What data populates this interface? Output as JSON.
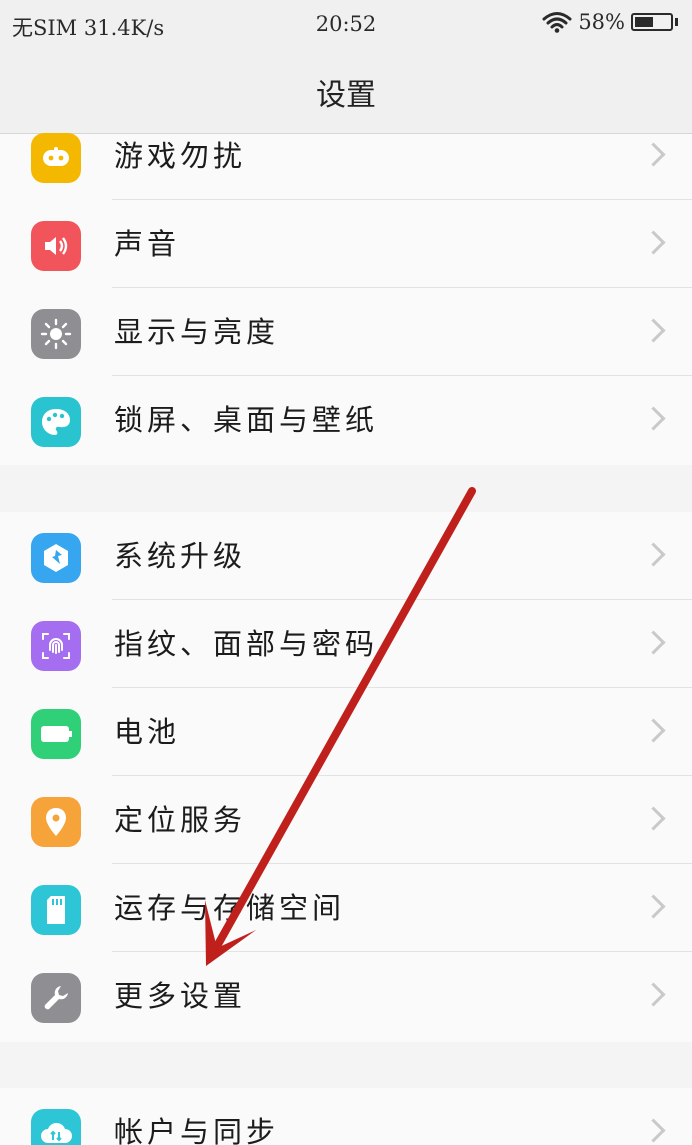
{
  "status": {
    "carrier": "无SIM 31.4K/s",
    "time": "20:52",
    "battery_percent": "58%",
    "battery_level": 0.58,
    "wifi": "wifi-icon"
  },
  "header": {
    "title": "设置"
  },
  "groups": [
    {
      "items": [
        {
          "label": "游戏勿扰",
          "icon": "gamepad-icon",
          "color": "#f5b800"
        },
        {
          "label": "声音",
          "icon": "speaker-icon",
          "color": "#f2545b"
        },
        {
          "label": "显示与亮度",
          "icon": "brightness-icon",
          "color": "#8e8e93"
        },
        {
          "label": "锁屏、桌面与壁纸",
          "icon": "palette-icon",
          "color": "#29c4cf"
        }
      ]
    },
    {
      "items": [
        {
          "label": "系统升级",
          "icon": "system-update-icon",
          "color": "#36a6f0"
        },
        {
          "label": "指纹、面部与密码",
          "icon": "fingerprint-icon",
          "color": "#a56ef0"
        },
        {
          "label": "电池",
          "icon": "battery-icon",
          "color": "#2fd078"
        },
        {
          "label": "定位服务",
          "icon": "location-pin-icon",
          "color": "#f6a33a"
        },
        {
          "label": "运存与存储空间",
          "icon": "sd-card-icon",
          "color": "#2ec6d6"
        },
        {
          "label": "更多设置",
          "icon": "wrench-icon",
          "color": "#8e8e93"
        }
      ]
    },
    {
      "items": [
        {
          "label": "帐户与同步",
          "icon": "cloud-sync-icon",
          "color": "#2ec6d6"
        }
      ]
    }
  ],
  "annotation": {
    "arrow_color": "#c0201c"
  }
}
